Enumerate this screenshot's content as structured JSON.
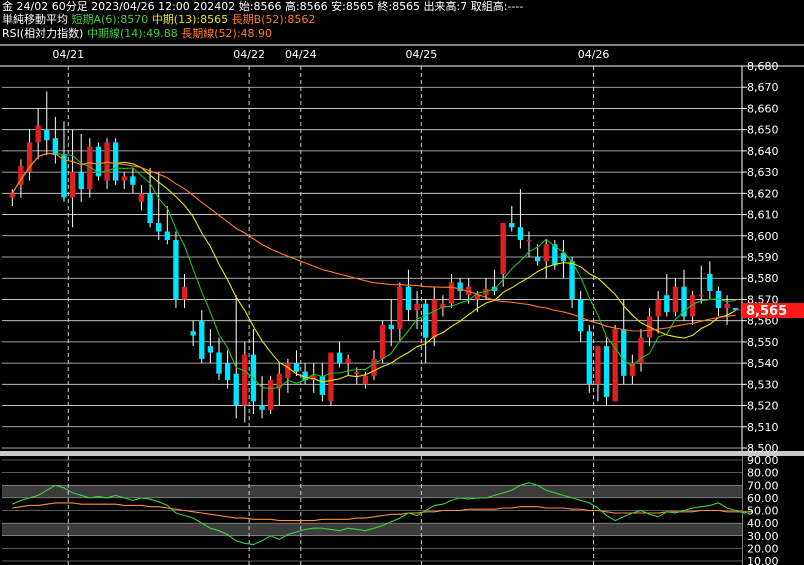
{
  "header": {
    "line1": "金 24/02 60分足 2023/04/26 12:00 202402 始:8566 高:8566 安:8565 終:8565 出来高:7 取組高:----",
    "ma_title": "単純移動平均",
    "ma_short": "短期A(6):8570",
    "ma_mid": "中期(13):8565",
    "ma_long": "長期B(52):8562",
    "rsi_title": "RSI(相対力指数)",
    "rsi_mid": "中期線(14):49.88",
    "rsi_long": "長期線(52):48.90"
  },
  "colors": {
    "up": "#e02020",
    "down": "#00e5ff",
    "ma6": "#22c022",
    "ma13": "#e8e800",
    "ma52": "#ff7a2a",
    "rsi14": "#3ecf3e",
    "rsi52": "#ff8c3a",
    "price_tag": "#ff1a1a"
  },
  "chart_data": [
    {
      "type": "candlestick",
      "title": "金 24/02 60分足",
      "date_labels": [
        {
          "label": "04/21",
          "index": 7
        },
        {
          "label": "04/22",
          "index": 28
        },
        {
          "label": "04/24",
          "index": 34
        },
        {
          "label": "04/25",
          "index": 48
        },
        {
          "label": "04/26",
          "index": 68
        }
      ],
      "ylim": [
        8500,
        8680
      ],
      "yticks": [
        8500,
        8510,
        8520,
        8530,
        8540,
        8550,
        8560,
        8570,
        8580,
        8590,
        8600,
        8610,
        8620,
        8630,
        8640,
        8650,
        8660,
        8670,
        8680
      ],
      "last_price": "8,565",
      "ohlc": [
        [
          8618,
          8622,
          8614,
          8620
        ],
        [
          8624,
          8636,
          8618,
          8633
        ],
        [
          8630,
          8650,
          8626,
          8644
        ],
        [
          8644,
          8660,
          8636,
          8652
        ],
        [
          8650,
          8668,
          8638,
          8645
        ],
        [
          8646,
          8656,
          8634,
          8638
        ],
        [
          8638,
          8654,
          8616,
          8618
        ],
        [
          8618,
          8650,
          8604,
          8630
        ],
        [
          8630,
          8648,
          8616,
          8622
        ],
        [
          8622,
          8646,
          8618,
          8642
        ],
        [
          8642,
          8644,
          8626,
          8628
        ],
        [
          8626,
          8646,
          8622,
          8644
        ],
        [
          8644,
          8646,
          8624,
          8626
        ],
        [
          8626,
          8630,
          8622,
          8628
        ],
        [
          8628,
          8632,
          8620,
          8624
        ],
        [
          8616,
          8624,
          8612,
          8620
        ],
        [
          8620,
          8632,
          8604,
          8606
        ],
        [
          8606,
          8630,
          8598,
          8602
        ],
        [
          8602,
          8614,
          8596,
          8598
        ],
        [
          8598,
          8602,
          8566,
          8570
        ],
        [
          8570,
          8582,
          8566,
          8576
        ],
        [
          8555,
          8560,
          8548,
          8553
        ],
        [
          8560,
          8565,
          8540,
          8542
        ],
        [
          8548,
          8556,
          8540,
          8545
        ],
        [
          8545,
          8552,
          8532,
          8535
        ],
        [
          8540,
          8546,
          8528,
          8532
        ],
        [
          8535,
          8572,
          8514,
          8520
        ],
        [
          8520,
          8550,
          8512,
          8544
        ],
        [
          8544,
          8556,
          8516,
          8522
        ],
        [
          8520,
          8534,
          8514,
          8518
        ],
        [
          8518,
          8534,
          8516,
          8532
        ],
        [
          8528,
          8540,
          8520,
          8535
        ],
        [
          8533,
          8542,
          8526,
          8540
        ],
        [
          8540,
          8546,
          8534,
          8536
        ],
        [
          8536,
          8540,
          8530,
          8532
        ],
        [
          8532,
          8540,
          8526,
          8534
        ],
        [
          8534,
          8540,
          8522,
          8525
        ],
        [
          8522,
          8544,
          8520,
          8545
        ],
        [
          8545,
          8550,
          8538,
          8540
        ],
        [
          8540,
          8544,
          8534,
          8542
        ],
        [
          8535,
          8538,
          8530,
          8536
        ],
        [
          8530,
          8536,
          8528,
          8534
        ],
        [
          8534,
          8546,
          8532,
          8542
        ],
        [
          8542,
          8560,
          8540,
          8558
        ],
        [
          8558,
          8570,
          8548,
          8556
        ],
        [
          8556,
          8578,
          8550,
          8576
        ],
        [
          8576,
          8584,
          8560,
          8565
        ],
        [
          8565,
          8574,
          8556,
          8568
        ],
        [
          8568,
          8570,
          8540,
          8552
        ],
        [
          8552,
          8576,
          8548,
          8570
        ],
        [
          8566,
          8572,
          8562,
          8568
        ],
        [
          8568,
          8582,
          8566,
          8578
        ],
        [
          8578,
          8580,
          8570,
          8574
        ],
        [
          8572,
          8580,
          8568,
          8576
        ],
        [
          8570,
          8574,
          8564,
          8572
        ],
        [
          8572,
          8580,
          8570,
          8575
        ],
        [
          8576,
          8584,
          8572,
          8574
        ],
        [
          8582,
          8602,
          8576,
          8606
        ],
        [
          8606,
          8614,
          8602,
          8604
        ],
        [
          8604,
          8622,
          8594,
          8598
        ],
        [
          8598,
          8602,
          8590,
          8598
        ],
        [
          8590,
          8596,
          8586,
          8588
        ],
        [
          8588,
          8598,
          8580,
          8596
        ],
        [
          8596,
          8598,
          8584,
          8586
        ],
        [
          8592,
          8598,
          8580,
          8588
        ],
        [
          8588,
          8590,
          8566,
          8570
        ],
        [
          8570,
          8574,
          8550,
          8555
        ],
        [
          8555,
          8558,
          8526,
          8530
        ],
        [
          8530,
          8540,
          8522,
          8548
        ],
        [
          8548,
          8552,
          8520,
          8524
        ],
        [
          8522,
          8558,
          8522,
          8556
        ],
        [
          8556,
          8570,
          8530,
          8534
        ],
        [
          8534,
          8544,
          8530,
          8540
        ],
        [
          8540,
          8556,
          8536,
          8552
        ],
        [
          8552,
          8566,
          8548,
          8562
        ],
        [
          8562,
          8574,
          8554,
          8570
        ],
        [
          8572,
          8582,
          8562,
          8564
        ],
        [
          8564,
          8580,
          8562,
          8576
        ],
        [
          8576,
          8584,
          8560,
          8562
        ],
        [
          8562,
          8574,
          8558,
          8572
        ],
        [
          8572,
          8586,
          8568,
          8572
        ],
        [
          8582,
          8588,
          8570,
          8574
        ],
        [
          8574,
          8576,
          8562,
          8566
        ],
        [
          8566,
          8572,
          8558,
          8568
        ],
        [
          8566,
          8566,
          8565,
          8565
        ]
      ],
      "ma_labels": [
        "短期A(6):8570",
        "中期(13):8565",
        "長期B(52):8562"
      ]
    },
    {
      "type": "line",
      "title": "RSI(相対力指数)",
      "ylim": [
        10,
        90
      ],
      "yticks": [
        10,
        20,
        30,
        40,
        50,
        60,
        70,
        80,
        90
      ],
      "ytick_labels": [
        "10.00",
        "20.00",
        "30.00",
        "40.00",
        "50.00",
        "60.00",
        "70.00",
        "80.00",
        "90.00"
      ],
      "bands": [
        [
          30,
          40
        ],
        [
          60,
          70
        ]
      ],
      "series": [
        {
          "name": "中期線(14)",
          "values": [
            55,
            58,
            60,
            62,
            66,
            70,
            68,
            64,
            62,
            60,
            61,
            60,
            62,
            60,
            58,
            60,
            59,
            57,
            54,
            48,
            46,
            44,
            40,
            36,
            34,
            31,
            26,
            24,
            23,
            26,
            30,
            27,
            31,
            33,
            35,
            36,
            36,
            35,
            34,
            36,
            35,
            34,
            36,
            38,
            41,
            44,
            48,
            46,
            50,
            54,
            55,
            58,
            60,
            59,
            60,
            60,
            62,
            64,
            66,
            70,
            72,
            70,
            66,
            64,
            62,
            60,
            58,
            56,
            52,
            46,
            42,
            45,
            48,
            50,
            47,
            45,
            49,
            48,
            50,
            52,
            53,
            54,
            56,
            52,
            50,
            48,
            50
          ]
        },
        {
          "name": "長期線(52)",
          "values": [
            52,
            53,
            54,
            54,
            55,
            56,
            56,
            56,
            55,
            55,
            55,
            55,
            55,
            54,
            54,
            54,
            53,
            53,
            52,
            51,
            50,
            49,
            48,
            47,
            46,
            45,
            44,
            44,
            43,
            43,
            43,
            42,
            42,
            42,
            42,
            42,
            43,
            43,
            43,
            43,
            44,
            44,
            45,
            46,
            47,
            47,
            48,
            48,
            49,
            49,
            50,
            50,
            50,
            51,
            51,
            51,
            51,
            52,
            52,
            53,
            53,
            53,
            52,
            52,
            52,
            51,
            51,
            50,
            50,
            49,
            48,
            48,
            48,
            48,
            48,
            48,
            49,
            49,
            49,
            49,
            50,
            50,
            50,
            49,
            49,
            49,
            49
          ]
        }
      ]
    }
  ]
}
